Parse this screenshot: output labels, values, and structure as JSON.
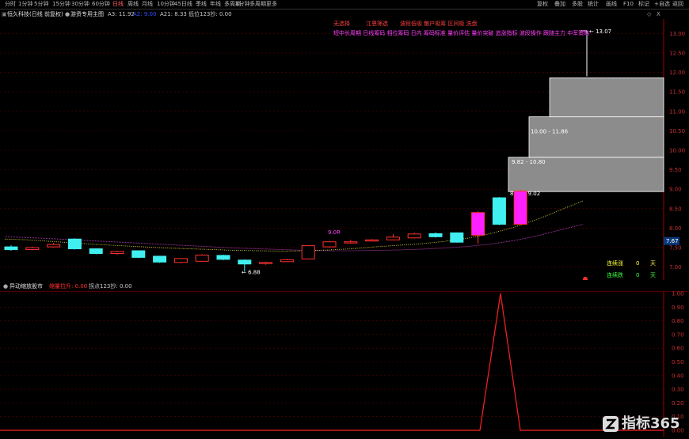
{
  "toolbar": {
    "left_tabs": [
      "分时",
      "1分钟",
      "5分钟",
      "15分钟",
      "30分钟",
      "60分钟",
      "日线",
      "周线",
      "月线",
      "10分钟",
      "45日线",
      "季线",
      "年线",
      "多周期",
      "1分钟",
      "多周期",
      "更多"
    ],
    "active_index": 6,
    "right_buttons": [
      "复权",
      "叠加",
      "多股",
      "统计",
      "画线",
      "F10",
      "标记",
      "+自选",
      "返回"
    ]
  },
  "info": {
    "stock": "恒久科技(日线 前复权)",
    "indicator": "游资专用主图",
    "a3": "A3: 11.92",
    "a2": "A2: 9.00",
    "a21": "A21: 8.33",
    "hold": "低位123抄: 0.00",
    "collapse_icon": "◇",
    "close_icon": "X"
  },
  "annotations": {
    "row1": [
      {
        "text": "无选择",
        "color": "#ff4040"
      },
      {
        "text": "江恩筛选",
        "color": "#ff4040"
      },
      {
        "text": "波段低吸 散户吸筹 区间吸 洗盘",
        "color": "#ff4040"
      }
    ],
    "row2": "短中长周期 日线筹码 相位筹码 日内 筹码标准 量价评估 量价突破 追涨指标 波段操作 跟随主力 中军策略",
    "range_labels": [
      "10.00 - 11.86",
      "9.82 - 10.80",
      "8.93 - 9.02"
    ],
    "high_label": "13.07",
    "low_label": "6.88",
    "mid_label": "9.0R"
  },
  "price_axis": {
    "ticks": [
      "13.00",
      "12.50",
      "12.00",
      "11.50",
      "11.00",
      "10.50",
      "10.00",
      "9.50",
      "9.00",
      "8.50",
      "8.00",
      "7.50",
      "7.00"
    ],
    "current": "7.67"
  },
  "streak": {
    "up_label": "连续涨",
    "up_value": "0",
    "up_unit": "天",
    "down_label": "连续跌",
    "down_value": "0",
    "down_unit": "天"
  },
  "sub_panel": {
    "title": "异动缩放股市",
    "signal": "缩量拉升: 0.00",
    "extra": "拐点123抄: 0.00",
    "ticks": [
      "1.00",
      "0.90",
      "0.80",
      "0.70",
      "0.60",
      "0.50",
      "0.40",
      "0.30",
      "0.20",
      "0.10",
      "0.00"
    ]
  },
  "watermark": {
    "text": "指标365"
  },
  "chart_data": {
    "type": "candlestick",
    "candles": [
      {
        "o": 7.52,
        "c": 7.45,
        "h": 7.56,
        "l": 7.42
      },
      {
        "o": 7.45,
        "c": 7.5,
        "h": 7.53,
        "l": 7.43
      },
      {
        "o": 7.52,
        "c": 7.58,
        "h": 7.62,
        "l": 7.5
      },
      {
        "o": 7.72,
        "c": 7.47,
        "h": 7.74,
        "l": 7.45
      },
      {
        "o": 7.47,
        "c": 7.35,
        "h": 7.48,
        "l": 7.33
      },
      {
        "o": 7.35,
        "c": 7.4,
        "h": 7.42,
        "l": 7.32
      },
      {
        "o": 7.42,
        "c": 7.25,
        "h": 7.43,
        "l": 7.23
      },
      {
        "o": 7.28,
        "c": 7.13,
        "h": 7.29,
        "l": 7.11
      },
      {
        "o": 7.12,
        "c": 7.22,
        "h": 7.23,
        "l": 7.1
      },
      {
        "o": 7.15,
        "c": 7.31,
        "h": 7.33,
        "l": 7.14
      },
      {
        "o": 7.3,
        "c": 7.2,
        "h": 7.32,
        "l": 7.18
      },
      {
        "o": 7.18,
        "c": 7.08,
        "h": 7.2,
        "l": 6.88
      },
      {
        "o": 7.1,
        "c": 7.12,
        "h": 7.14,
        "l": 7.06
      },
      {
        "o": 7.14,
        "c": 7.19,
        "h": 7.21,
        "l": 7.13
      },
      {
        "o": 7.21,
        "c": 7.55,
        "h": 7.56,
        "l": 7.2
      },
      {
        "o": 7.52,
        "c": 7.65,
        "h": 7.67,
        "l": 7.5
      },
      {
        "o": 7.65,
        "c": 7.65,
        "h": 7.7,
        "l": 7.6
      },
      {
        "o": 7.68,
        "c": 7.7,
        "h": 7.72,
        "l": 7.66
      },
      {
        "o": 7.7,
        "c": 7.77,
        "h": 7.85,
        "l": 7.69
      },
      {
        "o": 7.75,
        "c": 7.85,
        "h": 7.88,
        "l": 7.74
      },
      {
        "o": 7.86,
        "c": 7.78,
        "h": 7.89,
        "l": 7.76
      },
      {
        "o": 7.88,
        "c": 7.64,
        "h": 7.89,
        "l": 7.63
      },
      {
        "o": 7.82,
        "c": 8.4,
        "h": 8.44,
        "l": 7.6
      },
      {
        "o": 8.78,
        "c": 8.1,
        "h": 8.8,
        "l": 8.08
      },
      {
        "o": 8.1,
        "c": 8.95,
        "h": 8.98,
        "l": 8.08
      }
    ],
    "boxes": [
      {
        "from": 8.94,
        "to": 9.82
      },
      {
        "from": 9.82,
        "to": 10.86
      },
      {
        "from": 10.86,
        "to": 11.86
      }
    ],
    "yrange": [
      6.75,
      13.25
    ]
  }
}
